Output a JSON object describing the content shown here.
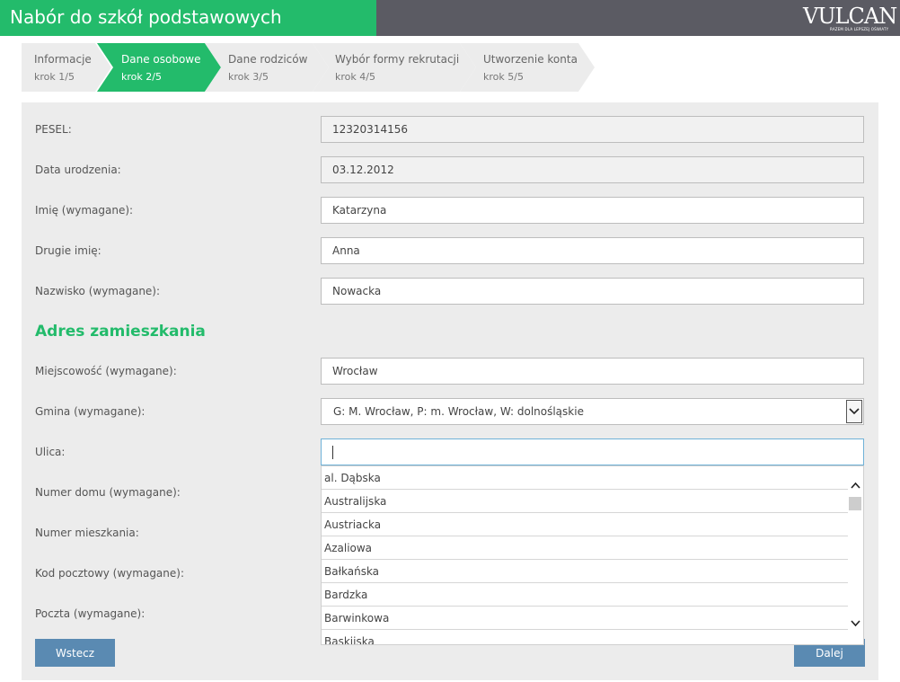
{
  "header": {
    "title": "Nabór do szkół podstawowych",
    "logo_text": "VULCAN",
    "logo_tagline": "RAZEM DLA LEPSZEJ OŚWIATY",
    "colors": {
      "accent": "#23bb6b",
      "bar": "#5b5b63"
    }
  },
  "steps": [
    {
      "title": "Informacje",
      "sub": "krok 1/5",
      "active": false
    },
    {
      "title": "Dane osobowe",
      "sub": "krok 2/5",
      "active": true
    },
    {
      "title": "Dane rodziców",
      "sub": "krok 3/5",
      "active": false
    },
    {
      "title": "Wybór formy rekrutacji",
      "sub": "krok 4/5",
      "active": false
    },
    {
      "title": "Utworzenie konta",
      "sub": "krok 5/5",
      "active": false
    }
  ],
  "form": {
    "pesel": {
      "label": "PESEL:",
      "value": "12320314156"
    },
    "birth_date": {
      "label": "Data urodzenia:",
      "value": "03.12.2012"
    },
    "first_name": {
      "label": "Imię (wymagane):",
      "value": "Katarzyna"
    },
    "second_name": {
      "label": "Drugie imię:",
      "value": "Anna"
    },
    "last_name": {
      "label": "Nazwisko (wymagane):",
      "value": "Nowacka"
    },
    "address_title": "Adres zamieszkania",
    "city": {
      "label": "Miejscowość (wymagane):",
      "value": "Wrocław"
    },
    "commune": {
      "label": "Gmina (wymagane):",
      "value": "G: M. Wrocław, P: m. Wrocław, W: dolnośląskie"
    },
    "street": {
      "label": "Ulica:",
      "value": ""
    },
    "house_number": {
      "label": "Numer domu (wymagane):"
    },
    "flat_number": {
      "label": "Numer mieszkania:"
    },
    "postal_code": {
      "label": "Kod pocztowy (wymagane):"
    },
    "post_office": {
      "label": "Poczta (wymagane):"
    }
  },
  "street_dropdown": {
    "items": [
      "al. Dąbska",
      "Australijska",
      "Austriacka",
      "Azaliowa",
      "Bałkańska",
      "Bardzka",
      "Barwinkowa",
      "Baskijska"
    ]
  },
  "buttons": {
    "back": "Wstecz",
    "next": "Dalej",
    "color": "#5a8ab2"
  },
  "icons": {
    "select_arrow": "chevron-down-icon",
    "scroll_up": "chevron-up-icon",
    "scroll_down": "chevron-down-icon"
  }
}
